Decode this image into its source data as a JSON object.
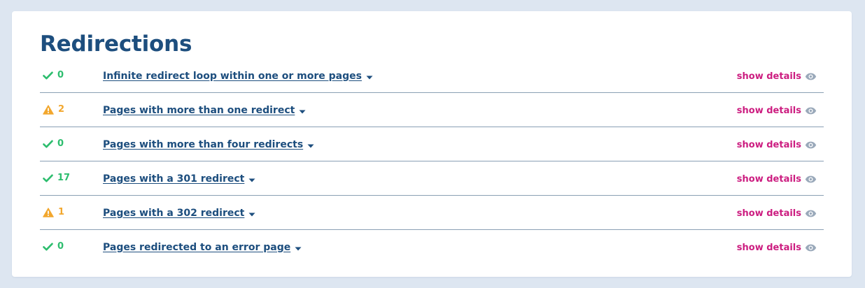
{
  "section": {
    "title": "Redirections"
  },
  "colors": {
    "ok": "#2dbd6e",
    "warning": "#f2a72e",
    "title": "#1d4e7e",
    "link": "#1d4e7e",
    "details": "#cc1d80",
    "eye_icon": "#9aa9ba"
  },
  "rows": [
    {
      "status": "ok",
      "status_icon": "check-icon",
      "count": "0",
      "label": "Infinite redirect loop within one or more pages",
      "details_label": "show details",
      "details_icon": "eye-icon"
    },
    {
      "status": "warning",
      "status_icon": "warning-icon",
      "count": "2",
      "label": "Pages with more than one redirect",
      "details_label": "show details",
      "details_icon": "eye-icon"
    },
    {
      "status": "ok",
      "status_icon": "check-icon",
      "count": "0",
      "label": "Pages with more than four redirects",
      "details_label": "show details",
      "details_icon": "eye-icon"
    },
    {
      "status": "ok",
      "status_icon": "check-icon",
      "count": "17",
      "label": "Pages with a 301 redirect",
      "details_label": "show details",
      "details_icon": "eye-icon"
    },
    {
      "status": "warning",
      "status_icon": "warning-icon",
      "count": "1",
      "label": "Pages with a 302 redirect",
      "details_label": "show details",
      "details_icon": "eye-icon"
    },
    {
      "status": "ok",
      "status_icon": "check-icon",
      "count": "0",
      "label": "Pages redirected to an error page",
      "details_label": "show details",
      "details_icon": "eye-icon"
    }
  ]
}
